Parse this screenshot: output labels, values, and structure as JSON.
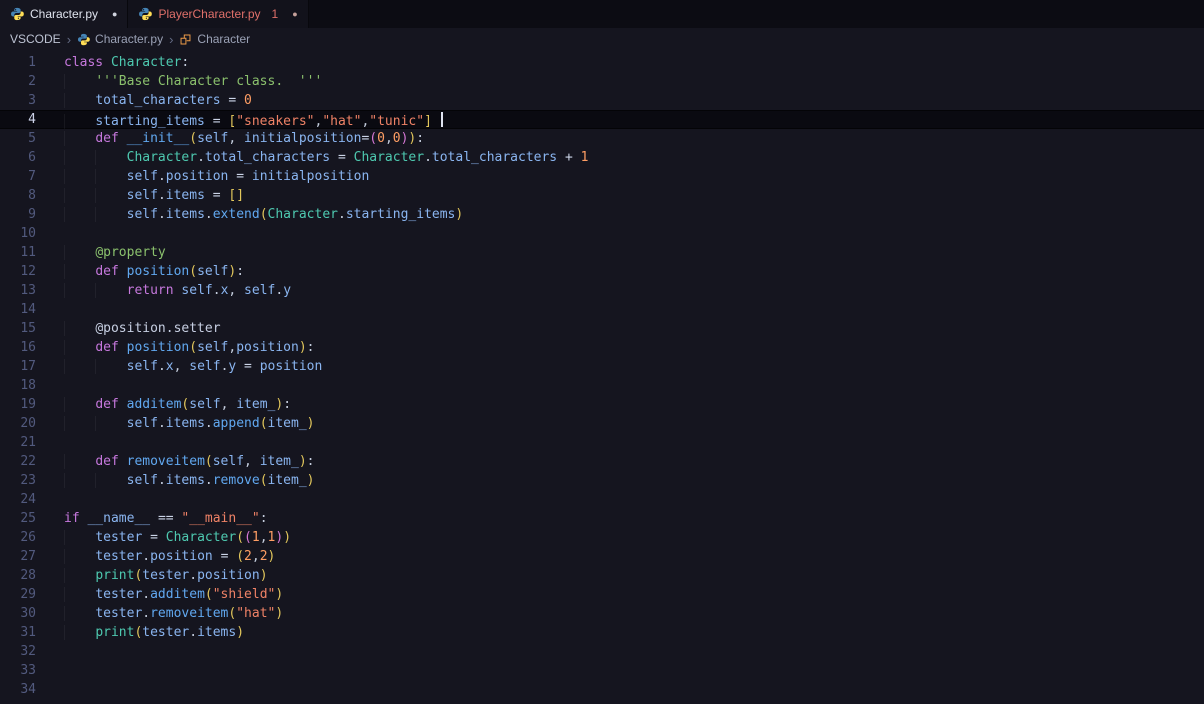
{
  "colors": {
    "background": "#15151f",
    "tab_bar": "#0c0c13",
    "current_line": "#0a0a11",
    "error": "#e0706a",
    "modified_dot": "#cfd3de",
    "tokens": {
      "k": "#c678dd",
      "c": "#4ec9b0",
      "f": "#61a8f0",
      "v": "#8ab5f0",
      "s": "#ef8266",
      "d": "#8bc16d",
      "a": "#8bc16d",
      "n": "#ff9e64",
      "o": "#ccd5e8",
      "p": "#c5cede",
      "g": "#e2c75c",
      "m": "#d678d6",
      "w": "#c7cfe2"
    }
  },
  "tabs": [
    {
      "label": "Character.py",
      "icon": "python-icon",
      "dirty": "●",
      "active": true
    },
    {
      "label": "PlayerCharacter.py",
      "icon": "python-icon",
      "badge": "1",
      "dirty": "●",
      "active": false
    }
  ],
  "breadcrumb": {
    "root": "VSCODE",
    "separator": "›",
    "file": "Character.py",
    "file_icon": "python-icon",
    "symbol": "Character",
    "symbol_icon": "symbol-class-icon"
  },
  "editor": {
    "active_line": 4,
    "lines": [
      {
        "n": 1,
        "indent": 0,
        "t": [
          [
            "k",
            "class"
          ],
          [
            "w",
            " "
          ],
          [
            "c",
            "Character"
          ],
          [
            "p",
            ":"
          ]
        ]
      },
      {
        "n": 2,
        "indent": 1,
        "t": [
          [
            "d",
            "'''Base Character class.  '''"
          ]
        ]
      },
      {
        "n": 3,
        "indent": 1,
        "t": [
          [
            "v",
            "total_characters"
          ],
          [
            "w",
            " "
          ],
          [
            "o",
            "="
          ],
          [
            "w",
            " "
          ],
          [
            "n",
            "0"
          ]
        ]
      },
      {
        "n": 4,
        "indent": 1,
        "cursor": true,
        "t": [
          [
            "v",
            "starting_items"
          ],
          [
            "w",
            " "
          ],
          [
            "o",
            "="
          ],
          [
            "w",
            " "
          ],
          [
            "g",
            "["
          ],
          [
            "s",
            "\"sneakers\""
          ],
          [
            "p",
            ","
          ],
          [
            "s",
            "\"hat\""
          ],
          [
            "p",
            ","
          ],
          [
            "s",
            "\"tunic\""
          ],
          [
            "g",
            "]"
          ],
          [
            "w",
            " "
          ]
        ]
      },
      {
        "n": 5,
        "indent": 1,
        "t": [
          [
            "k",
            "def"
          ],
          [
            "w",
            " "
          ],
          [
            "f",
            "__init__"
          ],
          [
            "g",
            "("
          ],
          [
            "v",
            "self"
          ],
          [
            "p",
            ","
          ],
          [
            "w",
            " "
          ],
          [
            "v",
            "initialposition"
          ],
          [
            "o",
            "="
          ],
          [
            "m",
            "("
          ],
          [
            "n",
            "0"
          ],
          [
            "p",
            ","
          ],
          [
            "n",
            "0"
          ],
          [
            "m",
            ")"
          ],
          [
            "g",
            ")"
          ],
          [
            "p",
            ":"
          ]
        ]
      },
      {
        "n": 6,
        "indent": 2,
        "t": [
          [
            "c",
            "Character"
          ],
          [
            "p",
            "."
          ],
          [
            "v",
            "total_characters"
          ],
          [
            "w",
            " "
          ],
          [
            "o",
            "="
          ],
          [
            "w",
            " "
          ],
          [
            "c",
            "Character"
          ],
          [
            "p",
            "."
          ],
          [
            "v",
            "total_characters"
          ],
          [
            "w",
            " "
          ],
          [
            "o",
            "+"
          ],
          [
            "w",
            " "
          ],
          [
            "n",
            "1"
          ]
        ]
      },
      {
        "n": 7,
        "indent": 2,
        "t": [
          [
            "v",
            "self"
          ],
          [
            "p",
            "."
          ],
          [
            "v",
            "position"
          ],
          [
            "w",
            " "
          ],
          [
            "o",
            "="
          ],
          [
            "w",
            " "
          ],
          [
            "v",
            "initialposition"
          ]
        ]
      },
      {
        "n": 8,
        "indent": 2,
        "t": [
          [
            "v",
            "self"
          ],
          [
            "p",
            "."
          ],
          [
            "v",
            "items"
          ],
          [
            "w",
            " "
          ],
          [
            "o",
            "="
          ],
          [
            "w",
            " "
          ],
          [
            "g",
            "[]"
          ]
        ]
      },
      {
        "n": 9,
        "indent": 2,
        "t": [
          [
            "v",
            "self"
          ],
          [
            "p",
            "."
          ],
          [
            "v",
            "items"
          ],
          [
            "p",
            "."
          ],
          [
            "f",
            "extend"
          ],
          [
            "g",
            "("
          ],
          [
            "c",
            "Character"
          ],
          [
            "p",
            "."
          ],
          [
            "v",
            "starting_items"
          ],
          [
            "g",
            ")"
          ]
        ]
      },
      {
        "n": 10,
        "indent": 0,
        "t": []
      },
      {
        "n": 11,
        "indent": 1,
        "t": [
          [
            "a",
            "@property"
          ]
        ]
      },
      {
        "n": 12,
        "indent": 1,
        "t": [
          [
            "k",
            "def"
          ],
          [
            "w",
            " "
          ],
          [
            "f",
            "position"
          ],
          [
            "g",
            "("
          ],
          [
            "v",
            "self"
          ],
          [
            "g",
            ")"
          ],
          [
            "p",
            ":"
          ]
        ]
      },
      {
        "n": 13,
        "indent": 2,
        "t": [
          [
            "k",
            "return"
          ],
          [
            "w",
            " "
          ],
          [
            "v",
            "self"
          ],
          [
            "p",
            "."
          ],
          [
            "v",
            "x"
          ],
          [
            "p",
            ","
          ],
          [
            "w",
            " "
          ],
          [
            "v",
            "self"
          ],
          [
            "p",
            "."
          ],
          [
            "v",
            "y"
          ]
        ]
      },
      {
        "n": 14,
        "indent": 0,
        "t": []
      },
      {
        "n": 15,
        "indent": 1,
        "t": [
          [
            "w",
            "@position.setter"
          ]
        ]
      },
      {
        "n": 16,
        "indent": 1,
        "t": [
          [
            "k",
            "def"
          ],
          [
            "w",
            " "
          ],
          [
            "f",
            "position"
          ],
          [
            "g",
            "("
          ],
          [
            "v",
            "self"
          ],
          [
            "p",
            ","
          ],
          [
            "v",
            "position"
          ],
          [
            "g",
            ")"
          ],
          [
            "p",
            ":"
          ]
        ]
      },
      {
        "n": 17,
        "indent": 2,
        "t": [
          [
            "v",
            "self"
          ],
          [
            "p",
            "."
          ],
          [
            "v",
            "x"
          ],
          [
            "p",
            ","
          ],
          [
            "w",
            " "
          ],
          [
            "v",
            "self"
          ],
          [
            "p",
            "."
          ],
          [
            "v",
            "y"
          ],
          [
            "w",
            " "
          ],
          [
            "o",
            "="
          ],
          [
            "w",
            " "
          ],
          [
            "v",
            "position"
          ]
        ]
      },
      {
        "n": 18,
        "indent": 0,
        "t": []
      },
      {
        "n": 19,
        "indent": 1,
        "t": [
          [
            "k",
            "def"
          ],
          [
            "w",
            " "
          ],
          [
            "f",
            "additem"
          ],
          [
            "g",
            "("
          ],
          [
            "v",
            "self"
          ],
          [
            "p",
            ","
          ],
          [
            "w",
            " "
          ],
          [
            "v",
            "item_"
          ],
          [
            "g",
            ")"
          ],
          [
            "p",
            ":"
          ]
        ]
      },
      {
        "n": 20,
        "indent": 2,
        "t": [
          [
            "v",
            "self"
          ],
          [
            "p",
            "."
          ],
          [
            "v",
            "items"
          ],
          [
            "p",
            "."
          ],
          [
            "f",
            "append"
          ],
          [
            "g",
            "("
          ],
          [
            "v",
            "item_"
          ],
          [
            "g",
            ")"
          ]
        ]
      },
      {
        "n": 21,
        "indent": 0,
        "t": []
      },
      {
        "n": 22,
        "indent": 1,
        "t": [
          [
            "k",
            "def"
          ],
          [
            "w",
            " "
          ],
          [
            "f",
            "removeitem"
          ],
          [
            "g",
            "("
          ],
          [
            "v",
            "self"
          ],
          [
            "p",
            ","
          ],
          [
            "w",
            " "
          ],
          [
            "v",
            "item_"
          ],
          [
            "g",
            ")"
          ],
          [
            "p",
            ":"
          ]
        ]
      },
      {
        "n": 23,
        "indent": 2,
        "t": [
          [
            "v",
            "self"
          ],
          [
            "p",
            "."
          ],
          [
            "v",
            "items"
          ],
          [
            "p",
            "."
          ],
          [
            "f",
            "remove"
          ],
          [
            "g",
            "("
          ],
          [
            "v",
            "item_"
          ],
          [
            "g",
            ")"
          ]
        ]
      },
      {
        "n": 24,
        "indent": 0,
        "t": []
      },
      {
        "n": 25,
        "indent": 0,
        "t": [
          [
            "k",
            "if"
          ],
          [
            "w",
            " "
          ],
          [
            "v",
            "__name__"
          ],
          [
            "w",
            " "
          ],
          [
            "o",
            "=="
          ],
          [
            "w",
            " "
          ],
          [
            "s",
            "\"__main__\""
          ],
          [
            "p",
            ":"
          ]
        ]
      },
      {
        "n": 26,
        "indent": 1,
        "t": [
          [
            "v",
            "tester"
          ],
          [
            "w",
            " "
          ],
          [
            "o",
            "="
          ],
          [
            "w",
            " "
          ],
          [
            "c",
            "Character"
          ],
          [
            "g",
            "("
          ],
          [
            "m",
            "("
          ],
          [
            "n",
            "1"
          ],
          [
            "p",
            ","
          ],
          [
            "n",
            "1"
          ],
          [
            "m",
            ")"
          ],
          [
            "g",
            ")"
          ]
        ]
      },
      {
        "n": 27,
        "indent": 1,
        "t": [
          [
            "v",
            "tester"
          ],
          [
            "p",
            "."
          ],
          [
            "v",
            "position"
          ],
          [
            "w",
            " "
          ],
          [
            "o",
            "="
          ],
          [
            "w",
            " "
          ],
          [
            "g",
            "("
          ],
          [
            "n",
            "2"
          ],
          [
            "p",
            ","
          ],
          [
            "n",
            "2"
          ],
          [
            "g",
            ")"
          ]
        ]
      },
      {
        "n": 28,
        "indent": 1,
        "t": [
          [
            "c",
            "print"
          ],
          [
            "g",
            "("
          ],
          [
            "v",
            "tester"
          ],
          [
            "p",
            "."
          ],
          [
            "v",
            "position"
          ],
          [
            "g",
            ")"
          ]
        ]
      },
      {
        "n": 29,
        "indent": 1,
        "t": [
          [
            "v",
            "tester"
          ],
          [
            "p",
            "."
          ],
          [
            "f",
            "additem"
          ],
          [
            "g",
            "("
          ],
          [
            "s",
            "\"shield\""
          ],
          [
            "g",
            ")"
          ]
        ]
      },
      {
        "n": 30,
        "indent": 1,
        "t": [
          [
            "v",
            "tester"
          ],
          [
            "p",
            "."
          ],
          [
            "f",
            "removeitem"
          ],
          [
            "g",
            "("
          ],
          [
            "s",
            "\"hat\""
          ],
          [
            "g",
            ")"
          ]
        ]
      },
      {
        "n": 31,
        "indent": 1,
        "t": [
          [
            "c",
            "print"
          ],
          [
            "g",
            "("
          ],
          [
            "v",
            "tester"
          ],
          [
            "p",
            "."
          ],
          [
            "v",
            "items"
          ],
          [
            "g",
            ")"
          ]
        ]
      },
      {
        "n": 32,
        "indent": 0,
        "t": []
      },
      {
        "n": 33,
        "indent": 0,
        "t": []
      },
      {
        "n": 34,
        "indent": 0,
        "t": []
      }
    ]
  }
}
